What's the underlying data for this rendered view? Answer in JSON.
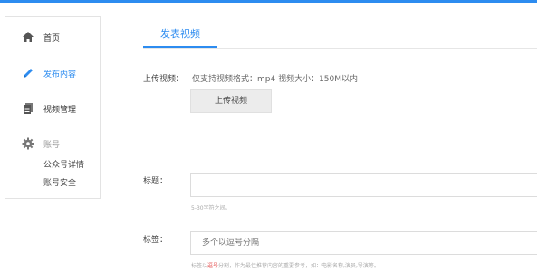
{
  "sidebar": {
    "items": [
      {
        "label": "首页",
        "icon": "home-icon"
      },
      {
        "label": "发布内容",
        "icon": "pencil-icon"
      },
      {
        "label": "视频管理",
        "icon": "document-icon"
      },
      {
        "label": "账号",
        "icon": "gear-icon"
      }
    ],
    "account_sub": [
      "公众号详情",
      "账号安全"
    ]
  },
  "main": {
    "tab_label": "发表视频",
    "upload": {
      "label": "上传视频：",
      "hint": "仅支持视频格式：mp4 视频大小：150M以内",
      "button_label": "上传视频"
    },
    "title_field": {
      "label": "标题：",
      "value": "",
      "note": "5-30字符之间。"
    },
    "tags_field": {
      "label": "标签：",
      "placeholder": "多个以逗号分隔",
      "note_before": "标签以",
      "note_highlight": "逗号",
      "note_after": "分割，作为最佳推荐内容的重要参考，如：电影名称,演员,导演等。"
    }
  },
  "colors": {
    "accent": "#2d8cf0",
    "highlight": "#e24b4b"
  }
}
